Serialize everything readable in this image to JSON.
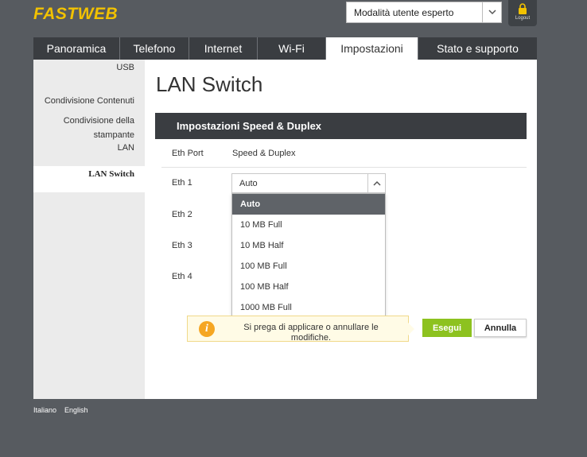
{
  "brand": {
    "logo_text": "FASTWEB",
    "accent_color": "#f2c200"
  },
  "header": {
    "mode_select": {
      "value": "Modalità utente esperto"
    },
    "logout_label": "Logout"
  },
  "nav": {
    "tabs": [
      {
        "label": "Panoramica"
      },
      {
        "label": "Telefono"
      },
      {
        "label": "Internet"
      },
      {
        "label": "Wi-Fi"
      },
      {
        "label": "Impostazioni",
        "active": true
      },
      {
        "label": "Stato e supporto"
      }
    ]
  },
  "sidebar": {
    "items": [
      {
        "label": "USB"
      },
      {
        "label": "Condivisione Contenuti"
      },
      {
        "label": "Condivisione della stampante"
      },
      {
        "label": "LAN"
      },
      {
        "label": "LAN Switch",
        "active": true
      }
    ]
  },
  "main": {
    "title": "LAN Switch",
    "section_title": "Impostazioni Speed & Duplex",
    "columns": {
      "port": "Eth Port",
      "speed": "Speed & Duplex"
    },
    "rows": [
      {
        "port": "Eth 1",
        "value": "Auto"
      },
      {
        "port": "Eth 2",
        "value": ""
      },
      {
        "port": "Eth 3",
        "value": ""
      },
      {
        "port": "Eth 4",
        "value": ""
      }
    ],
    "dropdown_options": [
      "Auto",
      "10 MB Full",
      "10 MB Half",
      "100 MB Full",
      "100 MB Half",
      "1000 MB Full"
    ],
    "dropdown_selected": "Auto",
    "notice": "Si prega di applicare o annullare le modifiche.",
    "apply_label": "Esegui",
    "cancel_label": "Annulla",
    "apply_color": "#8dc21f"
  },
  "footer": {
    "languages": [
      "Italiano",
      "English"
    ]
  }
}
